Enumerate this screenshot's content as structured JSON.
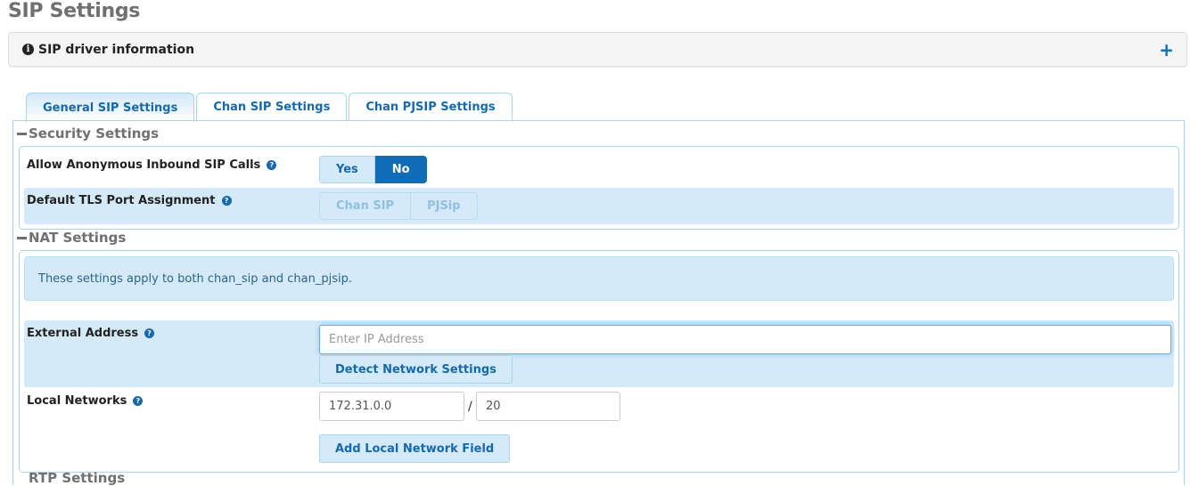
{
  "page": {
    "title": "SIP Settings"
  },
  "info_panel": {
    "icon": "info-circle-icon",
    "title": "SIP driver information",
    "expand_icon": "plus-icon"
  },
  "tabs": [
    {
      "label": "General SIP Settings",
      "active": true
    },
    {
      "label": "Chan SIP Settings",
      "active": false
    },
    {
      "label": "Chan PJSIP Settings",
      "active": false
    }
  ],
  "security": {
    "heading": "Security Settings",
    "anonymous": {
      "label": "Allow Anonymous Inbound SIP Calls",
      "options": [
        "Yes",
        "No"
      ],
      "selected": "No"
    },
    "tls": {
      "label": "Default TLS Port Assignment",
      "options": [
        "Chan SIP",
        "PJSip"
      ],
      "disabled": true
    }
  },
  "nat": {
    "heading": "NAT Settings",
    "notice": "These settings apply to both chan_sip and chan_pjsip.",
    "external": {
      "label": "External Address",
      "placeholder": "Enter IP Address",
      "value": "",
      "button": "Detect Network Settings"
    },
    "local": {
      "label": "Local Networks",
      "network": "172.31.0.0",
      "separator": "/",
      "cidr": "20",
      "button": "Add Local Network Field"
    }
  },
  "next_section": {
    "heading": "RTP Settings"
  },
  "icons": {
    "help": "?",
    "info": "i",
    "plus": "+"
  },
  "colors": {
    "accent": "#0f6cb5",
    "highlight": "#d4eaf9",
    "border": "#a9d3ee",
    "heading": "#707070"
  }
}
